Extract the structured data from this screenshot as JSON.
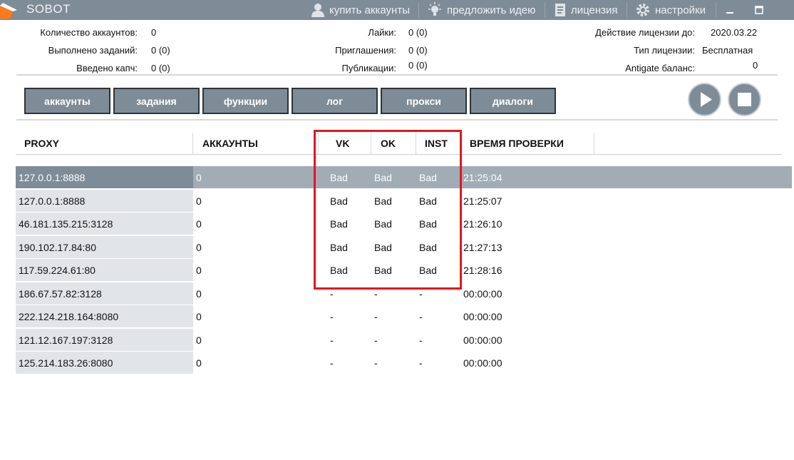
{
  "titlebar": {
    "app_title": "SOBOT",
    "buy_accounts": "купить аккаунты",
    "suggest_idea": "предложить идею",
    "license": "лицензия",
    "settings": "настройки"
  },
  "stats": {
    "accounts_count": {
      "label": "Количество аккаунтов:",
      "value": "0"
    },
    "tasks_done": {
      "label": "Выполнено заданий:",
      "value": "0 (0)"
    },
    "captchas_entered": {
      "label": "Введено капч:",
      "value": "0 (0)"
    },
    "likes": {
      "label": "Лайки:",
      "value": "0 (0)"
    },
    "invites": {
      "label": "Приглашения:",
      "value": "0 (0)"
    },
    "posts": {
      "label": "Публикации:",
      "value": "0 (0)"
    },
    "license_valid_until": {
      "label": "Действие лицензии до:",
      "value": "2020.03.22"
    },
    "license_type": {
      "label": "Тип лицензии:",
      "value": "Бесплатная"
    },
    "antigate_balance": {
      "label": "Antigate баланс:",
      "value": "0"
    }
  },
  "tabs": [
    "аккаунты",
    "задания",
    "функции",
    "лог",
    "прокси",
    "диалоги"
  ],
  "controls": {
    "play_icon": "play-icon",
    "stop_icon": "stop-icon"
  },
  "table": {
    "headers": {
      "proxy": "PROXY",
      "accounts": "АККАУНТЫ",
      "vk": "VK",
      "ok": "OK",
      "inst": "INST",
      "check_time": "ВРЕМЯ ПРОВЕРКИ"
    },
    "rows": [
      {
        "proxy": "127.0.0.1:8888",
        "accounts": "0",
        "vk": "Bad",
        "ok": "Bad",
        "inst": "Bad",
        "time": "21:25:04",
        "selected": true
      },
      {
        "proxy": "127.0.0.1:8888",
        "accounts": "0",
        "vk": "Bad",
        "ok": "Bad",
        "inst": "Bad",
        "time": "21:25:07"
      },
      {
        "proxy": "46.181.135.215:3128",
        "accounts": "0",
        "vk": "Bad",
        "ok": "Bad",
        "inst": "Bad",
        "time": "21:26:10"
      },
      {
        "proxy": "190.102.17.84:80",
        "accounts": "0",
        "vk": "Bad",
        "ok": "Bad",
        "inst": "Bad",
        "time": "21:27:13"
      },
      {
        "proxy": "117.59.224.61:80",
        "accounts": "0",
        "vk": "Bad",
        "ok": "Bad",
        "inst": "Bad",
        "time": "21:28:16"
      },
      {
        "proxy": "186.67.57.82:3128",
        "accounts": "0",
        "vk": "-",
        "ok": "-",
        "inst": "-",
        "time": "00:00:00"
      },
      {
        "proxy": "222.124.218.164:8080",
        "accounts": "0",
        "vk": "-",
        "ok": "-",
        "inst": "-",
        "time": "00:00:00"
      },
      {
        "proxy": "121.12.167.197:3128",
        "accounts": "0",
        "vk": "-",
        "ok": "-",
        "inst": "-",
        "time": "00:00:00"
      },
      {
        "proxy": "125.214.183.26:8080",
        "accounts": "0",
        "vk": "-",
        "ok": "-",
        "inst": "-",
        "time": "00:00:00"
      }
    ]
  },
  "colors": {
    "accent": "#7e8c98",
    "highlight": "#e8141c",
    "logo": "#ff7a1a"
  }
}
